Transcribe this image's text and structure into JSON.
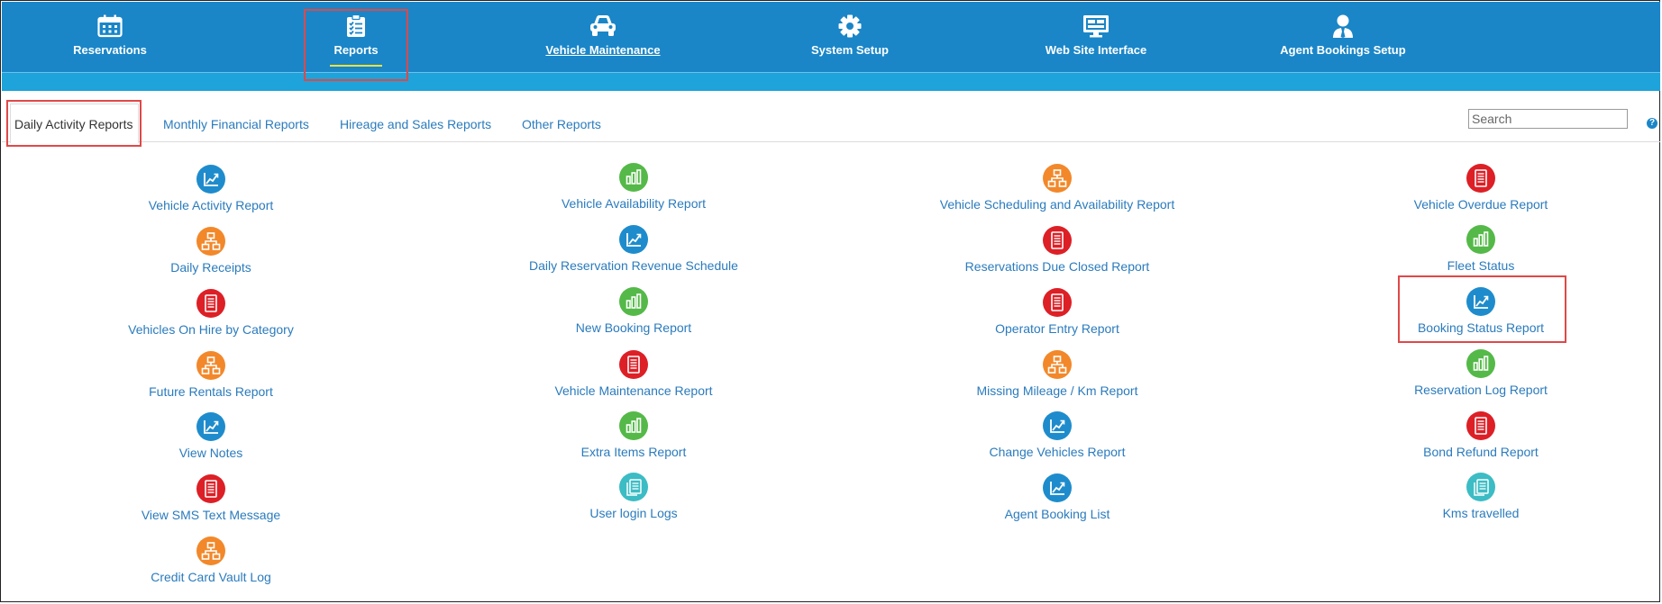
{
  "nav": {
    "items": [
      {
        "label": "Reservations",
        "icon": "calendar-icon"
      },
      {
        "label": "Reports",
        "icon": "checklist-icon"
      },
      {
        "label": "Vehicle Maintenance",
        "icon": "car-icon"
      },
      {
        "label": "System Setup",
        "icon": "gear-icon"
      },
      {
        "label": "Web Site Interface",
        "icon": "monitor-icon"
      },
      {
        "label": "Agent Bookings Setup",
        "icon": "agent-icon"
      }
    ],
    "active": "Reports"
  },
  "tabs": [
    {
      "label": "Daily Activity Reports",
      "active": true
    },
    {
      "label": "Monthly Financial Reports"
    },
    {
      "label": "Hireage and Sales Reports"
    },
    {
      "label": "Other Reports"
    }
  ],
  "search": {
    "placeholder": "Search"
  },
  "help": {
    "label": "?"
  },
  "colors": {
    "nav_bg": "#1a86c8",
    "link": "#2a7bbd",
    "highlight": "#e04848",
    "icon_blue": "#1e8ccc",
    "icon_orange": "#f2882a",
    "icon_red": "#dd1f26",
    "icon_green": "#54b948",
    "icon_teal": "#3cbcc4"
  },
  "reports": {
    "col1": [
      {
        "label": "Vehicle Activity Report",
        "icon": "blue-chart-icon"
      },
      {
        "label": "Daily Receipts",
        "icon": "orange-hierarchy-icon"
      },
      {
        "label": "Vehicles On Hire by Category",
        "icon": "red-document-icon"
      },
      {
        "label": "Future Rentals Report",
        "icon": "orange-hierarchy-icon"
      },
      {
        "label": "View Notes",
        "icon": "blue-chart-icon"
      },
      {
        "label": "View SMS Text Message",
        "icon": "red-document-icon"
      },
      {
        "label": "Credit Card Vault Log",
        "icon": "orange-hierarchy-icon"
      }
    ],
    "col2": [
      {
        "label": "Vehicle Availability Report",
        "icon": "green-bars-icon"
      },
      {
        "label": "Daily Reservation Revenue Schedule",
        "icon": "blue-chart-icon"
      },
      {
        "label": "New Booking Report",
        "icon": "green-bars-icon"
      },
      {
        "label": "Vehicle Maintenance Report",
        "icon": "red-document-icon"
      },
      {
        "label": "Extra Items Report",
        "icon": "green-bars-icon"
      },
      {
        "label": "User login Logs",
        "icon": "teal-docs-icon"
      }
    ],
    "col3": [
      {
        "label": "Vehicle Scheduling and Availability Report",
        "icon": "orange-hierarchy-icon"
      },
      {
        "label": "Reservations Due Closed Report",
        "icon": "red-document-icon"
      },
      {
        "label": "Operator Entry Report",
        "icon": "red-document-icon"
      },
      {
        "label": "Missing Mileage / Km Report",
        "icon": "orange-hierarchy-icon"
      },
      {
        "label": "Change Vehicles Report",
        "icon": "blue-chart-icon"
      },
      {
        "label": "Agent Booking List",
        "icon": "blue-chart-icon"
      }
    ],
    "col4": [
      {
        "label": "Vehicle Overdue Report",
        "icon": "red-document-icon"
      },
      {
        "label": "Fleet Status",
        "icon": "green-bars-icon"
      },
      {
        "label": "Booking Status Report",
        "icon": "blue-chart-icon"
      },
      {
        "label": "Reservation Log Report",
        "icon": "green-bars-icon"
      },
      {
        "label": "Bond Refund Report",
        "icon": "red-document-icon"
      },
      {
        "label": "Kms travelled",
        "icon": "teal-docs-icon"
      }
    ]
  }
}
